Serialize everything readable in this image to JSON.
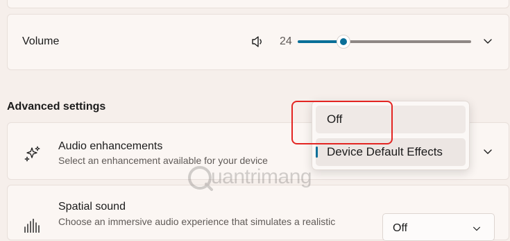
{
  "volume": {
    "label": "Volume",
    "value": "24",
    "level_percent": 24
  },
  "advanced": {
    "heading": "Advanced settings"
  },
  "audio_enhancements": {
    "title": "Audio enhancements",
    "subtitle": "Select an enhancement available for your device"
  },
  "spatial_sound": {
    "title": "Spatial sound",
    "subtitle": "Choose an immersive audio experience that simulates a realistic",
    "selected": "Off"
  },
  "dropdown": {
    "options": [
      {
        "label": "Off",
        "selected": false
      },
      {
        "label": "Device Default Effects",
        "selected": true
      }
    ]
  },
  "watermark": {
    "text": "uantrimang"
  },
  "colors": {
    "accent": "#0a6f98",
    "highlight": "#e32522"
  },
  "icons": {
    "volume": "speaker-icon",
    "audio": "sparkle-icon",
    "spatial": "sound-wave-icon",
    "chevron": "chevron-down-icon"
  }
}
